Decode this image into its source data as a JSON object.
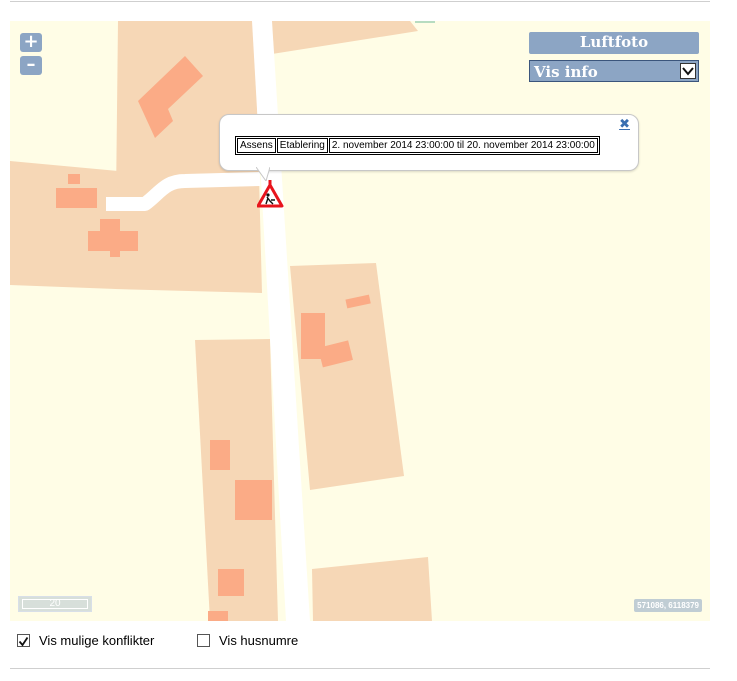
{
  "map": {
    "zoom_in_label": "+",
    "zoom_out_label": "–",
    "layer_button_label": "Luftfoto",
    "info_select": {
      "selected": "Vis info"
    },
    "popup": {
      "close_label": "✖",
      "row": [
        "Assens",
        "Etablering",
        "2. november 2014 23:00:00 til 20. november 2014 23:00:00"
      ]
    },
    "scale_label": "20",
    "coordinates": "571086, 6118379",
    "marker_icon": "roadwork-warning-icon",
    "colors": {
      "background": "#fffde6",
      "parcel": "#f6d7b6",
      "building": "#fbab86",
      "road": "#ffffff",
      "control": "#8ca5c4",
      "marker": "#e8141c"
    }
  },
  "options": [
    {
      "label": "Vis mulige konflikter",
      "checked": true
    },
    {
      "label": "Vis husnumre",
      "checked": false
    }
  ]
}
